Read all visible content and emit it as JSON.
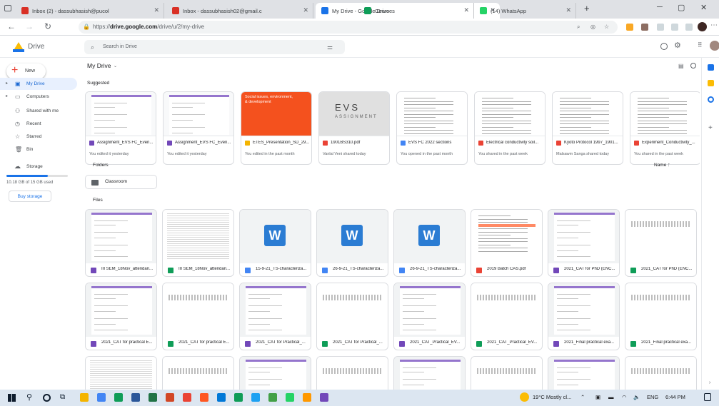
{
  "browser": {
    "tabs": [
      {
        "label": "Inbox (2) - dassubhasish@pucol",
        "color": "#d93025",
        "icon": "gmail-icon"
      },
      {
        "label": "Inbox - dassubhasish02@gmail.c",
        "color": "#d93025",
        "icon": "gmail-icon"
      },
      {
        "label": "My Drive - Google Drive",
        "color": "#1a73e8",
        "icon": "drive-icon"
      },
      {
        "label": "Courses",
        "color": "#0f9d58",
        "icon": "classroom-icon"
      },
      {
        "label": "(14) WhatsApp",
        "color": "#25d366",
        "icon": "whatsapp-icon"
      }
    ],
    "url_prefix": "https://",
    "url_host": "drive.google.com",
    "url_path": "/drive/u/2/my-drive"
  },
  "drive": {
    "app_name": "Drive",
    "search_placeholder": "Search in Drive",
    "new_label": "New",
    "title": "My Drive",
    "sidebar": [
      {
        "label": "My Drive",
        "icon": "my-drive-icon",
        "glyph": "▣",
        "selected": true
      },
      {
        "label": "Computers",
        "icon": "computers-icon",
        "glyph": "▭",
        "selected": false
      },
      {
        "label": "Shared with me",
        "icon": "shared-icon",
        "glyph": "⚇",
        "selected": false
      },
      {
        "label": "Recent",
        "icon": "recent-icon",
        "glyph": "◷",
        "selected": false
      },
      {
        "label": "Starred",
        "icon": "star-icon",
        "glyph": "☆",
        "selected": false
      },
      {
        "label": "Bin",
        "icon": "bin-icon",
        "glyph": "🗑",
        "selected": false
      }
    ],
    "storage_label": "Storage",
    "storage_used": "10.18 GB of 15 GB used",
    "storage_fraction": 0.68,
    "buy_storage": "Buy storage",
    "suggested_title": "Suggested",
    "suggested": [
      {
        "name": "Assignment_EVS FC_Even...",
        "sub": "You edited it yesterday",
        "kind": "form",
        "color": "#7248b9"
      },
      {
        "name": "Assignment_EVS FC_Even...",
        "sub": "You edited it yesterday",
        "kind": "form",
        "color": "#7248b9"
      },
      {
        "name": "ETES_Presentation_SD_29...",
        "sub": "You edited in the past month",
        "kind": "slides",
        "color": "#f4b400"
      },
      {
        "name": "1901BS310.pdf",
        "sub": "Vanlal Veni shared today",
        "kind": "photo",
        "color": "#ea4335"
      },
      {
        "name": "EVS FC 2022 sections",
        "sub": "You opened in the past month",
        "kind": "doc",
        "color": "#4285f4"
      },
      {
        "name": "Electrical conductivity soil...",
        "sub": "You shared in the past week",
        "kind": "pdf",
        "color": "#ea4335"
      },
      {
        "name": "Kyoto Protocol 1997_1901...",
        "sub": "Malsawm Sanga shared today",
        "kind": "pdf",
        "color": "#ea4335"
      },
      {
        "name": "Experiment_Conductivity_...",
        "sub": "You shared in the past week",
        "kind": "pdf",
        "color": "#ea4335"
      }
    ],
    "slides_text": "Social issues, environment, & development",
    "evs_text": "EVS",
    "evs_sub": "ASSIGNMENT",
    "folders_title": "Folders",
    "sort_label": "Name",
    "folders": [
      {
        "name": "Classroom"
      }
    ],
    "files_title": "Files",
    "files": [
      {
        "name": "III SEM_18Nov_attendan...",
        "kind": "form",
        "color": "#7248b9"
      },
      {
        "name": "III SEM_18Nov_attendan...",
        "kind": "sheet",
        "color": "#0f9d58"
      },
      {
        "name": "15-9-21_TS-characteriza...",
        "kind": "word",
        "color": "#4285f4"
      },
      {
        "name": "26-9-21_TS-characteriza...",
        "kind": "word",
        "color": "#4285f4"
      },
      {
        "name": "26-9-21_TS-characteriza...",
        "kind": "word",
        "color": "#4285f4"
      },
      {
        "name": "2019 Batch CAS.pdf",
        "kind": "table",
        "color": "#ea4335"
      },
      {
        "name": "2021_CAT for PhD (ENC...",
        "kind": "form",
        "color": "#7248b9"
      },
      {
        "name": "2021_CAT for PhD (ENC...",
        "kind": "sheetstrip",
        "color": "#0f9d58"
      },
      {
        "name": "2021_CAT for practical E...",
        "kind": "form",
        "color": "#7248b9"
      },
      {
        "name": "2021_CAT for practical E...",
        "kind": "sheetstrip",
        "color": "#0f9d58"
      },
      {
        "name": "2021_CAT for Practical_...",
        "kind": "form",
        "color": "#7248b9"
      },
      {
        "name": "2021_CAT for Practical_...",
        "kind": "sheetstrip",
        "color": "#0f9d58"
      },
      {
        "name": "2021_CAT_Practical_EV...",
        "kind": "form",
        "color": "#7248b9"
      },
      {
        "name": "2021_CAT_Practical_EV...",
        "kind": "sheetstrip",
        "color": "#0f9d58"
      },
      {
        "name": "2021_Final practical exa...",
        "kind": "form",
        "color": "#7248b9"
      },
      {
        "name": "2021_Final practical exa...",
        "kind": "sheetstrip",
        "color": "#0f9d58"
      },
      {
        "name": "",
        "kind": "sheet",
        "color": "#0f9d58"
      },
      {
        "name": "",
        "kind": "sheetstrip",
        "color": "#0f9d58"
      },
      {
        "name": "",
        "kind": "form",
        "color": "#7248b9"
      },
      {
        "name": "",
        "kind": "sheetstrip",
        "color": "#0f9d58"
      },
      {
        "name": "",
        "kind": "form",
        "color": "#7248b9"
      },
      {
        "name": "",
        "kind": "sheetstrip",
        "color": "#0f9d58"
      },
      {
        "name": "",
        "kind": "form",
        "color": "#7248b9"
      },
      {
        "name": "",
        "kind": "sheetstrip",
        "color": "#0f9d58"
      }
    ]
  },
  "taskbar": {
    "weather": "19°C  Mostly cl...",
    "lang": "ENG",
    "time": "6:44 PM",
    "apps": [
      "#f4b400",
      "#4285f4",
      "#0f9d58",
      "#2b579a",
      "#217346",
      "#d24726",
      "#ea4335",
      "#ff5722",
      "#0078d7",
      "#0f9d58",
      "#1da1f2",
      "#43a047",
      "#25d366",
      "#ff9800",
      "#7248b9"
    ]
  }
}
